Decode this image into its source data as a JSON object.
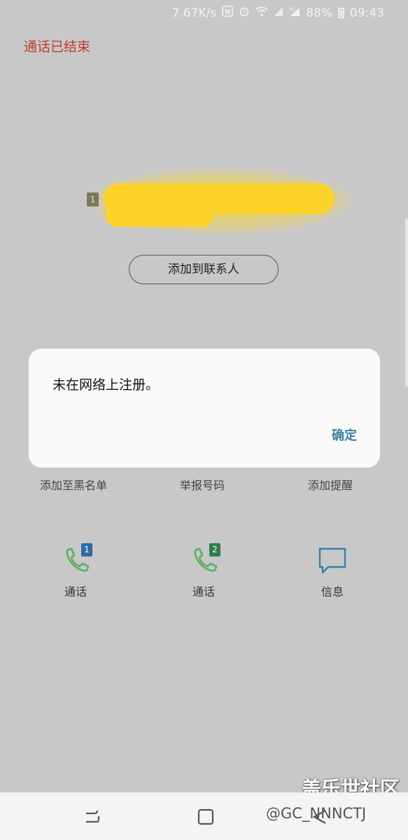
{
  "status_bar": {
    "net_speed": "7.67K/s",
    "battery_pct": "88%",
    "time": "09:43",
    "icons": [
      "nfc-icon",
      "alarm-icon",
      "wifi-icon",
      "signal-icon",
      "4g-signal-icon",
      "battery-icon"
    ]
  },
  "call": {
    "status": "通话已结束",
    "sim_badge": "1",
    "add_contact_label": "添加到联系人"
  },
  "dialog": {
    "message": "未在网络上注册。",
    "ok_label": "确定"
  },
  "options": {
    "block": "添加至黑名单",
    "report": "举报号码",
    "reminder": "添加提醒"
  },
  "actions": [
    {
      "label": "通话",
      "sim": "1",
      "icon": "phone-sim1-icon",
      "color": "#2e6da4"
    },
    {
      "label": "通话",
      "sim": "2",
      "icon": "phone-sim2-icon",
      "color": "#2e7d4a"
    },
    {
      "label": "信息",
      "icon": "message-icon"
    }
  ],
  "watermark": {
    "title": "盖乐世社区",
    "user": "@GC_NNNCTJ"
  },
  "colors": {
    "accent_ok": "#3a7fa8",
    "status_red": "#c0392b",
    "phone_green": "#5fae63"
  }
}
